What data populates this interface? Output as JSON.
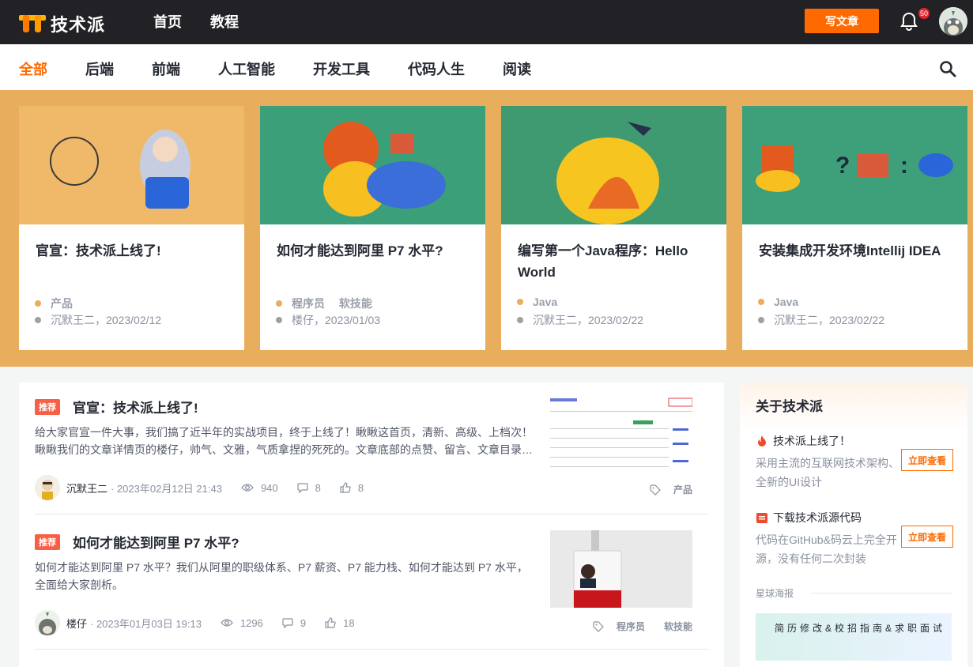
{
  "header": {
    "logo_text": "技术派",
    "nav": [
      "首页",
      "教程"
    ],
    "write_label": "写文章",
    "notification_count": "50"
  },
  "categories": [
    "全部",
    "后端",
    "前端",
    "人工智能",
    "开发工具",
    "代码人生",
    "阅读"
  ],
  "active_category": "全部",
  "banner_cards": [
    {
      "title": "官宣：技术派上线了!",
      "tags": "产品",
      "author_date": "沉默王二，2023/02/12"
    },
    {
      "title": "如何才能达到阿里 P7 水平?",
      "tags": "程序员　 软技能",
      "author_date": "楼仔，2023/01/03"
    },
    {
      "title": "编写第一个Java程序：Hello World",
      "tags": "Java",
      "author_date": "沉默王二，2023/02/22"
    },
    {
      "title": "安装集成开发环境Intellij IDEA",
      "tags": "Java",
      "author_date": "沉默王二，2023/02/22"
    }
  ],
  "articles": [
    {
      "badge": "推荐",
      "title": "官宣：技术派上线了!",
      "desc": "给大家官宣一件大事，我们搞了近半年的实战项目，终于上线了！瞅瞅这首页，清新、高级、上档次！瞅瞅我们的文章详情页的楼仔，帅气、文雅，气质拿捏的死死的。文章底部的点赞、留言、文章目录…",
      "author": "沉默王二",
      "time": "· 2023年02月12日 21:43",
      "views": "940",
      "comments": "8",
      "likes": "8",
      "tags": [
        "产品"
      ]
    },
    {
      "badge": "推荐",
      "title": "如何才能达到阿里 P7 水平?",
      "desc": "如何才能达到阿里 P7 水平？我们从阿里的职级体系、P7 薪资、P7 能力栈、如何才能达到 P7 水平，全面给大家剖析。",
      "author": "楼仔",
      "time": "· 2023年01月03日 19:13",
      "views": "1296",
      "comments": "9",
      "likes": "18",
      "tags": [
        "程序员",
        "软技能"
      ]
    }
  ],
  "sidebar": {
    "title": "关于技术派",
    "items": [
      {
        "title": "技术派上线了！",
        "desc": "采用主流的互联网技术架构、全新的UI设计",
        "button": "立即查看",
        "icon": "fire-icon"
      },
      {
        "title": "下载技术派源代码",
        "desc": "代码在GitHub&码云上完全开源，没有任何二次封装",
        "button": "立即查看",
        "icon": "code-icon"
      }
    ],
    "poster_label": "星球海报",
    "poster_text": "简历修改&校招指南&求职面试"
  },
  "colors": {
    "accent": "#ff6a00",
    "banner_bg": "#e8ad5d",
    "topbar": "#222226"
  }
}
